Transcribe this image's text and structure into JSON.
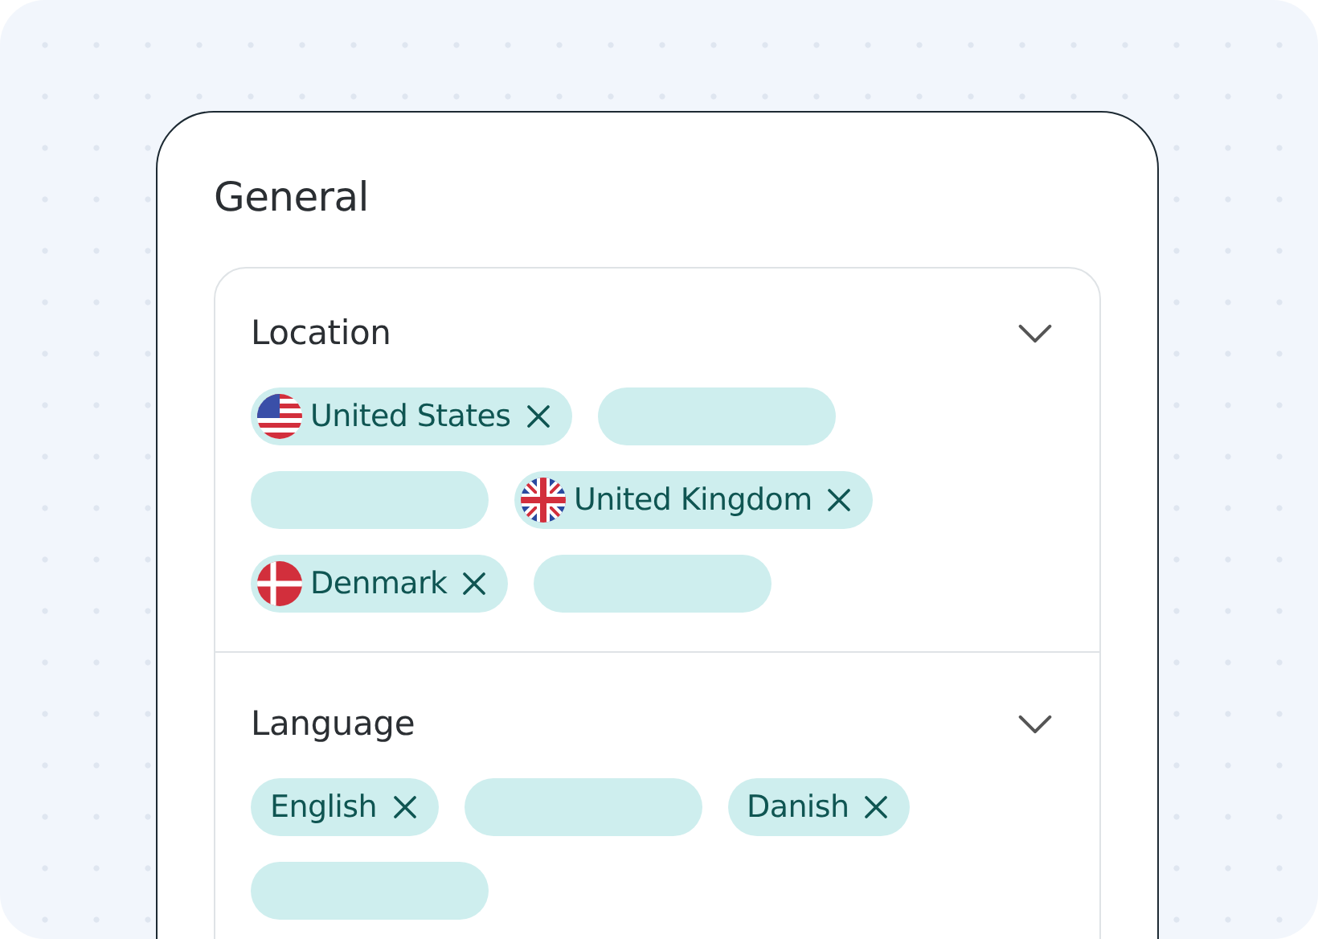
{
  "card": {
    "title": "General"
  },
  "sections": [
    {
      "title": "Location",
      "expanded": true,
      "chips": [
        {
          "kind": "usflagtag",
          "label": "United States"
        },
        {
          "kind": "skeleton"
        },
        {
          "kind": "skeleton"
        },
        {
          "kind": "ukflagtag",
          "label": "United Kingdom"
        },
        {
          "kind": "dkflagtag",
          "label": "Denmark"
        },
        {
          "kind": "skeleton"
        }
      ]
    },
    {
      "title": "Language",
      "expanded": true,
      "chips": [
        {
          "kind": "tag",
          "label": "English"
        },
        {
          "kind": "skeleton"
        },
        {
          "kind": "tag",
          "label": "Danish"
        },
        {
          "kind": "skeleton"
        }
      ]
    }
  ]
}
